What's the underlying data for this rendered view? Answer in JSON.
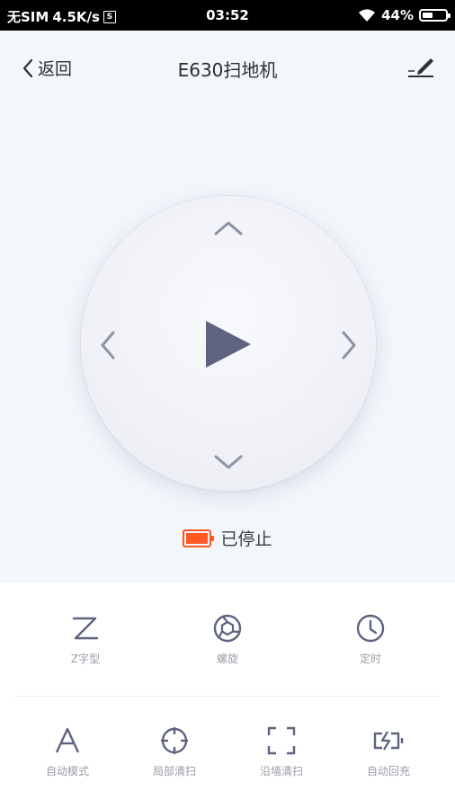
{
  "statusbar": {
    "carrier": "无SIM",
    "speed": "4.5K/s",
    "sim_icon_text": "S",
    "time": "03:52",
    "battery": "44%",
    "battery_level": 0.44
  },
  "nav": {
    "back_label": "返回",
    "title": "E630扫地机",
    "edit_icon": "edit-pen-icon"
  },
  "control": {
    "status": "已停止",
    "battery_color": "#ff5722"
  },
  "modes_top": [
    {
      "label": "Z字型",
      "icon": "z-pattern-icon"
    },
    {
      "label": "螺旋",
      "icon": "spiral-icon"
    },
    {
      "label": "定时",
      "icon": "clock-icon"
    }
  ],
  "modes_bottom": [
    {
      "label": "自动模式",
      "icon": "auto-mode-icon"
    },
    {
      "label": "局部清扫",
      "icon": "spot-clean-icon"
    },
    {
      "label": "沿墙清扫",
      "icon": "edge-clean-icon"
    },
    {
      "label": "自动回充",
      "icon": "recharge-icon"
    }
  ],
  "colors": {
    "icon": "#5e6380",
    "accent_battery": "#ff5722",
    "background": "#f3f6fa"
  }
}
